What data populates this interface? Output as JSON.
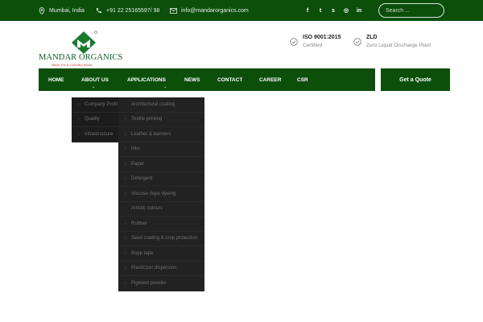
{
  "topbar": {
    "location": "Mumbai, India",
    "phone": "+91 22 25165597/ 98",
    "email": "info@mandarorganics.com",
    "social": [
      {
        "name": "facebook-icon",
        "glyph": "f"
      },
      {
        "name": "twitter-icon",
        "glyph": "t"
      },
      {
        "name": "skype-icon",
        "glyph": "s"
      },
      {
        "name": "instagram-icon",
        "glyph": "◎"
      },
      {
        "name": "linkedin-icon",
        "glyph": "in"
      }
    ],
    "search_placeholder": "Search ..."
  },
  "brand": {
    "name": "MANDAR ORGANICS",
    "tagline": "Never For A Colourful World",
    "colors": {
      "green": "#0e5c1e",
      "accent": "#0b4f0b"
    }
  },
  "certs": [
    {
      "title": "ISO 9001:2015",
      "subtitle": "Certified"
    },
    {
      "title": "ZLD",
      "subtitle": "Zero Liquid Discharge Plant"
    }
  ],
  "nav": {
    "items": [
      "HOME",
      "ABOUT US",
      "APPLICATIONS",
      "NEWS",
      "CONTACT",
      "CAREER",
      "CSR"
    ],
    "cta": "Get a Quote"
  },
  "about_menu": [
    "Company Profil",
    "Quality",
    "Infrastructure"
  ],
  "applications_menu": [
    "Architectural coating",
    "Textile printing",
    "Leather & banners",
    "Inks",
    "Paper",
    "Detergent",
    "Viscose dope dyeing",
    "Artistic colours",
    "Rubber",
    "Seed coating & crop protection",
    "Bopp tape",
    "Plasticizer dispersion",
    "Pigment powder"
  ]
}
